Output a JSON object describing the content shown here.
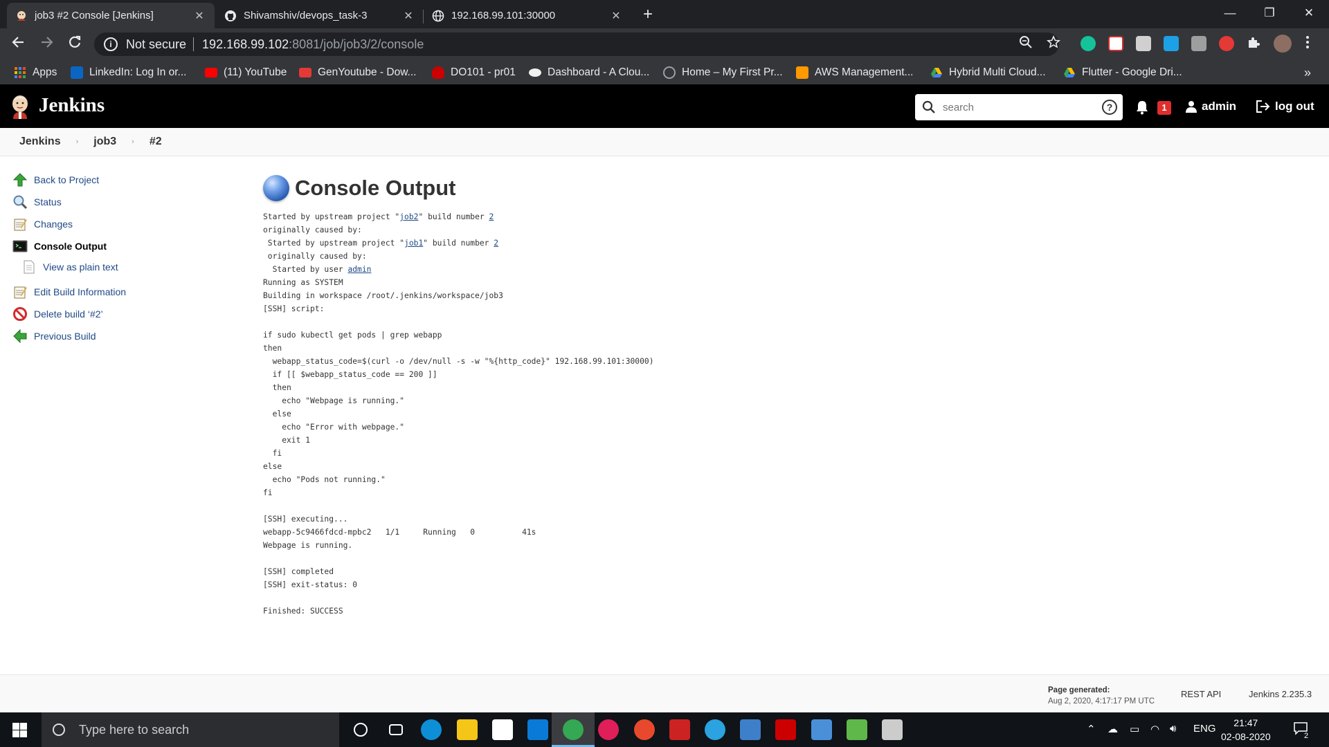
{
  "browser": {
    "tabs": [
      {
        "title": "job3 #2 Console [Jenkins]",
        "icon": "jenkins-favicon"
      },
      {
        "title": "Shivamshiv/devops_task-3",
        "icon": "github-favicon"
      },
      {
        "title": "192.168.99.101:30000",
        "icon": "globe-favicon"
      }
    ],
    "tab_close": "✕",
    "new_tab": "+",
    "window_controls": {
      "minimize": "—",
      "restore": "❐",
      "close": "✕"
    },
    "address": {
      "security": "Not secure",
      "host": "192.168.99.102",
      "path": ":8081/job/job3/2/console"
    },
    "bookmarks": [
      {
        "label": "Apps",
        "color": "#e8710a"
      },
      {
        "label": "LinkedIn: Log In or...",
        "color": "#0a66c2"
      },
      {
        "label": "(11) YouTube",
        "color": "#ff0000"
      },
      {
        "label": "GenYoutube - Dow...",
        "color": "#e53935"
      },
      {
        "label": "DO101 - pr01",
        "color": "#cc0000"
      },
      {
        "label": "Dashboard - A Clou...",
        "color": "#f0f0f0"
      },
      {
        "label": "Home – My First Pr...",
        "color": "#9aa0a6"
      },
      {
        "label": "AWS Management...",
        "color": "#ff9900"
      },
      {
        "label": "Hybrid Multi Cloud...",
        "color": "#fbbc04"
      },
      {
        "label": "Flutter - Google Dri...",
        "color": "#34a853"
      }
    ],
    "bookmarks_more": "»"
  },
  "jenkins": {
    "title": "Jenkins",
    "search_placeholder": "search",
    "help": "?",
    "notifications": "1",
    "user": "admin",
    "logout": "log out",
    "breadcrumb": [
      "Jenkins",
      "job3",
      "#2"
    ],
    "sidebar": [
      {
        "label": "Back to Project",
        "icon": "up-arrow-icon",
        "sub": false,
        "current": false
      },
      {
        "label": "Status",
        "icon": "magnifier-icon",
        "sub": false,
        "current": false
      },
      {
        "label": "Changes",
        "icon": "notepad-icon",
        "sub": false,
        "current": false
      },
      {
        "label": "Console Output",
        "icon": "terminal-icon",
        "sub": false,
        "current": true
      },
      {
        "label": "View as plain text",
        "icon": "document-icon",
        "sub": true,
        "current": false
      },
      {
        "label": "Edit Build Information",
        "icon": "notepad-icon",
        "sub": false,
        "current": false
      },
      {
        "label": "Delete build ‘#2’",
        "icon": "no-entry-icon",
        "sub": false,
        "current": false
      },
      {
        "label": "Previous Build",
        "icon": "left-arrow-icon",
        "sub": false,
        "current": false
      }
    ],
    "page_title": "Console Output",
    "console_lines": [
      [
        {
          "t": "Started by upstream project \""
        },
        {
          "t": "job2",
          "link": true
        },
        {
          "t": "\" build number "
        },
        {
          "t": "2",
          "link": true
        }
      ],
      [
        {
          "t": "originally caused by:"
        }
      ],
      [
        {
          "t": " Started by upstream project \""
        },
        {
          "t": "job1",
          "link": true
        },
        {
          "t": "\" build number "
        },
        {
          "t": "2",
          "link": true
        }
      ],
      [
        {
          "t": " originally caused by:"
        }
      ],
      [
        {
          "t": "  Started by user "
        },
        {
          "t": "admin",
          "link": true
        }
      ],
      [
        {
          "t": "Running as SYSTEM"
        }
      ],
      [
        {
          "t": "Building in workspace /root/.jenkins/workspace/job3"
        }
      ],
      [
        {
          "t": "[SSH] script:"
        }
      ],
      [
        {
          "t": ""
        }
      ],
      [
        {
          "t": "if sudo kubectl get pods | grep webapp"
        }
      ],
      [
        {
          "t": "then"
        }
      ],
      [
        {
          "t": "  webapp_status_code=$(curl -o /dev/null -s -w \"%{http_code}\" 192.168.99.101:30000)"
        }
      ],
      [
        {
          "t": "  if [[ $webapp_status_code == 200 ]]"
        }
      ],
      [
        {
          "t": "  then"
        }
      ],
      [
        {
          "t": "    echo \"Webpage is running.\""
        }
      ],
      [
        {
          "t": "  else"
        }
      ],
      [
        {
          "t": "    echo \"Error with webpage.\""
        }
      ],
      [
        {
          "t": "    exit 1"
        }
      ],
      [
        {
          "t": "  fi"
        }
      ],
      [
        {
          "t": "else"
        }
      ],
      [
        {
          "t": "  echo \"Pods not running.\""
        }
      ],
      [
        {
          "t": "fi"
        }
      ],
      [
        {
          "t": ""
        }
      ],
      [
        {
          "t": "[SSH] executing..."
        }
      ],
      [
        {
          "t": "webapp-5c9466fdcd-mpbc2   1/1     Running   0          41s"
        }
      ],
      [
        {
          "t": "Webpage is running."
        }
      ],
      [
        {
          "t": ""
        }
      ],
      [
        {
          "t": "[SSH] completed"
        }
      ],
      [
        {
          "t": "[SSH] exit-status: 0"
        }
      ],
      [
        {
          "t": ""
        }
      ],
      [
        {
          "t": "Finished: SUCCESS"
        }
      ]
    ],
    "footer": {
      "page_generated_label": "Page generated:",
      "page_generated_time": "Aug 2, 2020, 4:17:17 PM UTC",
      "rest_api": "REST API",
      "version": "Jenkins 2.235.3"
    }
  },
  "taskbar": {
    "search_placeholder": "Type here to search",
    "apps": [
      {
        "name": "cortana-icon",
        "color": "#ffffff"
      },
      {
        "name": "task-view-icon",
        "color": "#ffffff"
      },
      {
        "name": "edge-icon",
        "color": "#0c8fd6"
      },
      {
        "name": "file-explorer-icon",
        "color": "#f5c518"
      },
      {
        "name": "store-icon",
        "color": "#ffffff"
      },
      {
        "name": "mail-icon",
        "color": "#0a7ad8"
      },
      {
        "name": "chrome-icon",
        "color": "#34a853"
      },
      {
        "name": "slack-icon",
        "color": "#e01e5a"
      },
      {
        "name": "postman-icon",
        "color": "#e8492c"
      },
      {
        "name": "red-web-icon",
        "color": "#cc2222"
      },
      {
        "name": "telegram-icon",
        "color": "#2aa3e0"
      },
      {
        "name": "virtualbox-icon",
        "color": "#3d7fc9"
      },
      {
        "name": "rhel-icon",
        "color": "#cc0000"
      },
      {
        "name": "network-icon",
        "color": "#4a90d9"
      },
      {
        "name": "git-icon",
        "color": "#5fb84a"
      },
      {
        "name": "terminal-app-icon",
        "color": "#cccccc"
      }
    ],
    "tray": {
      "lang": "ENG",
      "time": "21:47",
      "date": "02-08-2020",
      "notifications": "2"
    }
  }
}
